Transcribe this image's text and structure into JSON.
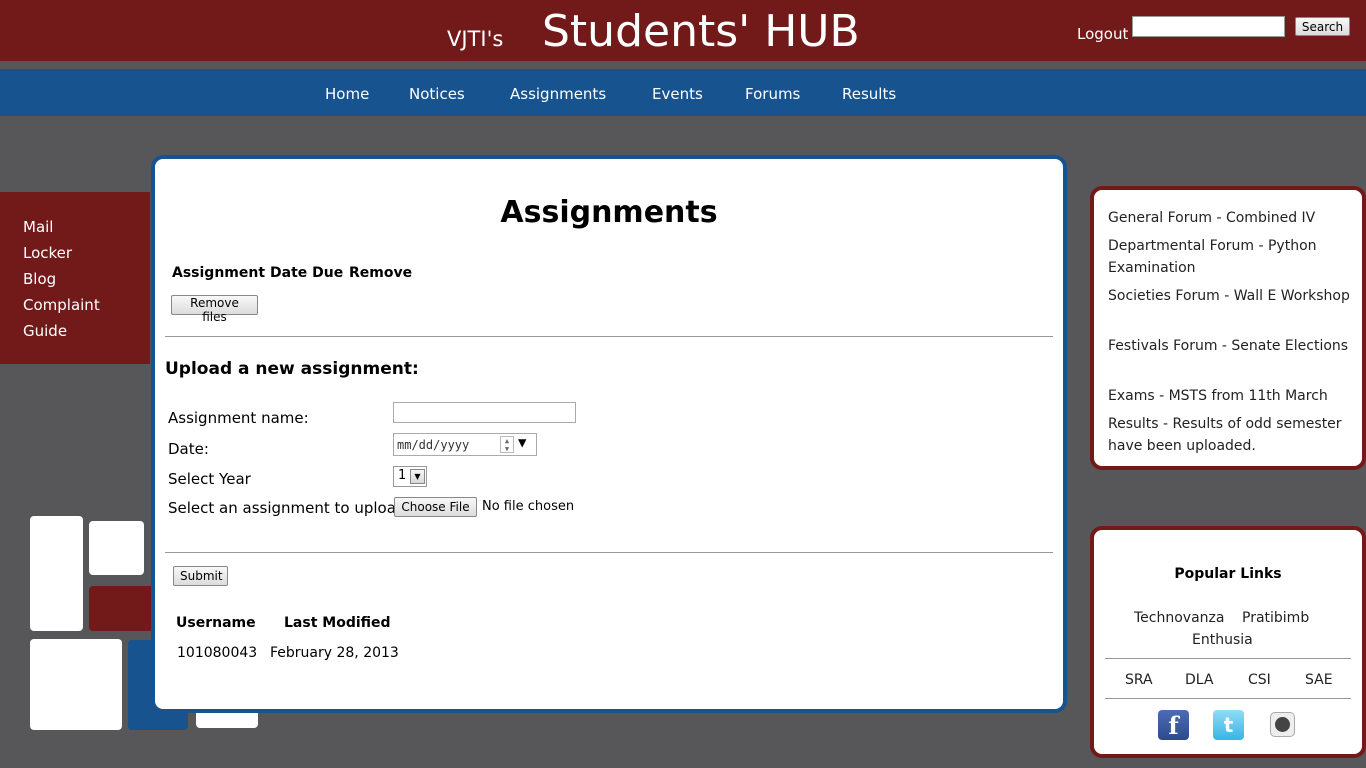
{
  "header": {
    "brand_small": "VJTI's",
    "brand_big": "Students' HUB",
    "logout_label": "Logout",
    "search_button": "Search",
    "search_value": ""
  },
  "nav": {
    "items": [
      "Home",
      "Notices",
      "Assignments",
      "Events",
      "Forums",
      "Results"
    ]
  },
  "sidebar": {
    "items": [
      "Mail",
      "Locker",
      "Blog",
      "Complaint",
      "Guide"
    ]
  },
  "main": {
    "title": "Assignments",
    "assignments_table": {
      "headers": [
        "Assignment",
        "Date Due",
        "Remove"
      ],
      "rows": []
    },
    "remove_button": "Remove files",
    "upload_heading": "Upload a new assignment:",
    "form": {
      "name_label": "Assignment name:",
      "name_value": "",
      "date_label": "Date:",
      "date_placeholder": "mm/dd/yyyy",
      "year_label": "Select Year",
      "year_value": "1",
      "file_label": "Select an assignment to upload",
      "choose_file_button": "Choose File",
      "no_file_text": "No file chosen"
    },
    "submit_button": "Submit",
    "modified_table": {
      "headers": [
        "Username",
        "Last Modified"
      ],
      "rows": [
        [
          "101080043",
          "February 28, 2013"
        ]
      ]
    }
  },
  "news": {
    "items": [
      "General Forum - Combined IV",
      "Departmental Forum - Python Examination",
      "Societies Forum - Wall E Workshop",
      "Festivals Forum - Senate Elections",
      "Exams - MSTS from 11th March",
      "Results - Results of odd semester have been uploaded."
    ]
  },
  "popular_links": {
    "title": "Popular Links",
    "fests": [
      "Technovanza",
      "Pratibimb",
      "Enthusia"
    ],
    "clubs": [
      "SRA",
      "DLA",
      "CSI",
      "SAE"
    ],
    "social": [
      "facebook-icon",
      "twitter-icon",
      "github-icon"
    ]
  },
  "colors": {
    "header_red": "#721a1a",
    "nav_blue": "#17538f",
    "background": "#57575a"
  }
}
